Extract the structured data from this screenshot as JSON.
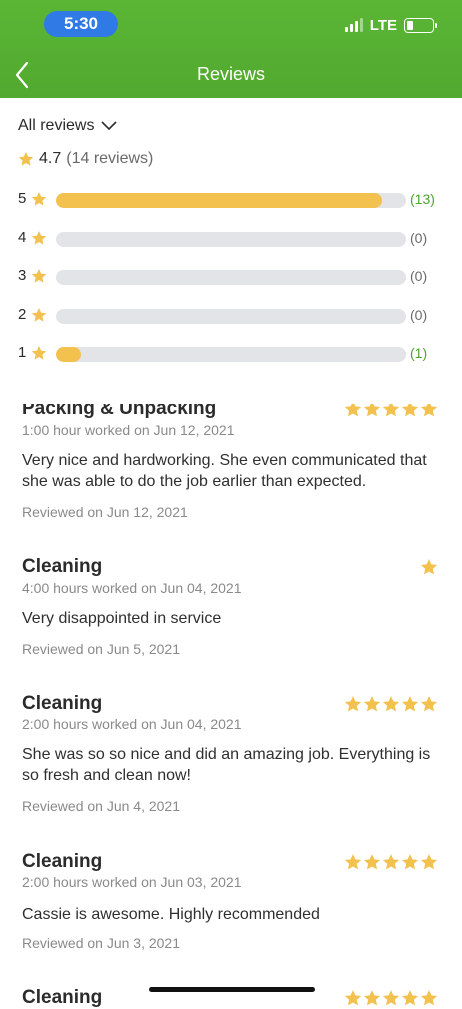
{
  "status_bar": {
    "time": "5:30",
    "network": "LTE"
  },
  "header": {
    "title": "Reviews",
    "back_icon": "chevron-left-icon"
  },
  "summary": {
    "filter_label": "All reviews",
    "average": "4.7",
    "review_count": "(14 reviews)",
    "rows": [
      {
        "label": "5",
        "count": "(13)",
        "fraction": 0.93,
        "highlight": true
      },
      {
        "label": "4",
        "count": "(0)",
        "fraction": 0.0,
        "highlight": false
      },
      {
        "label": "3",
        "count": "(0)",
        "fraction": 0.0,
        "highlight": false
      },
      {
        "label": "2",
        "count": "(0)",
        "fraction": 0.0,
        "highlight": false
      },
      {
        "label": "1",
        "count": "(1)",
        "fraction": 0.07,
        "highlight": true
      }
    ]
  },
  "reviews": [
    {
      "title": "Packing & Unpacking",
      "worked": "1:00 hour worked on Jun 12, 2021",
      "body": "Very nice and hardworking. She even communicated that she was able to do the job earlier than expected.",
      "date": "Reviewed on Jun 12, 2021",
      "stars": 5
    },
    {
      "title": "Cleaning",
      "worked": "4:00 hours worked on Jun 04, 2021",
      "body": "Very disappointed in service",
      "date": "Reviewed on Jun 5, 2021",
      "stars": 1
    },
    {
      "title": "Cleaning",
      "worked": "2:00 hours worked on Jun 04, 2021",
      "body": "She was so so nice and did an amazing job. Everything is so fresh and clean now!",
      "date": "Reviewed on Jun 4, 2021",
      "stars": 5
    },
    {
      "title": "Cleaning",
      "worked": "2:00 hours worked on Jun 03, 2021",
      "body": "Cassie is awesome. Highly recommended",
      "date": "Reviewed on Jun 3, 2021",
      "stars": 5
    },
    {
      "title": "Cleaning",
      "stars": 5
    }
  ],
  "colors": {
    "header_green": "#55af31",
    "star_gold": "#f2c14e",
    "count_green": "#4ca52d",
    "track_gray": "#e3e4e8",
    "time_pill_blue": "#2f7ae5"
  }
}
